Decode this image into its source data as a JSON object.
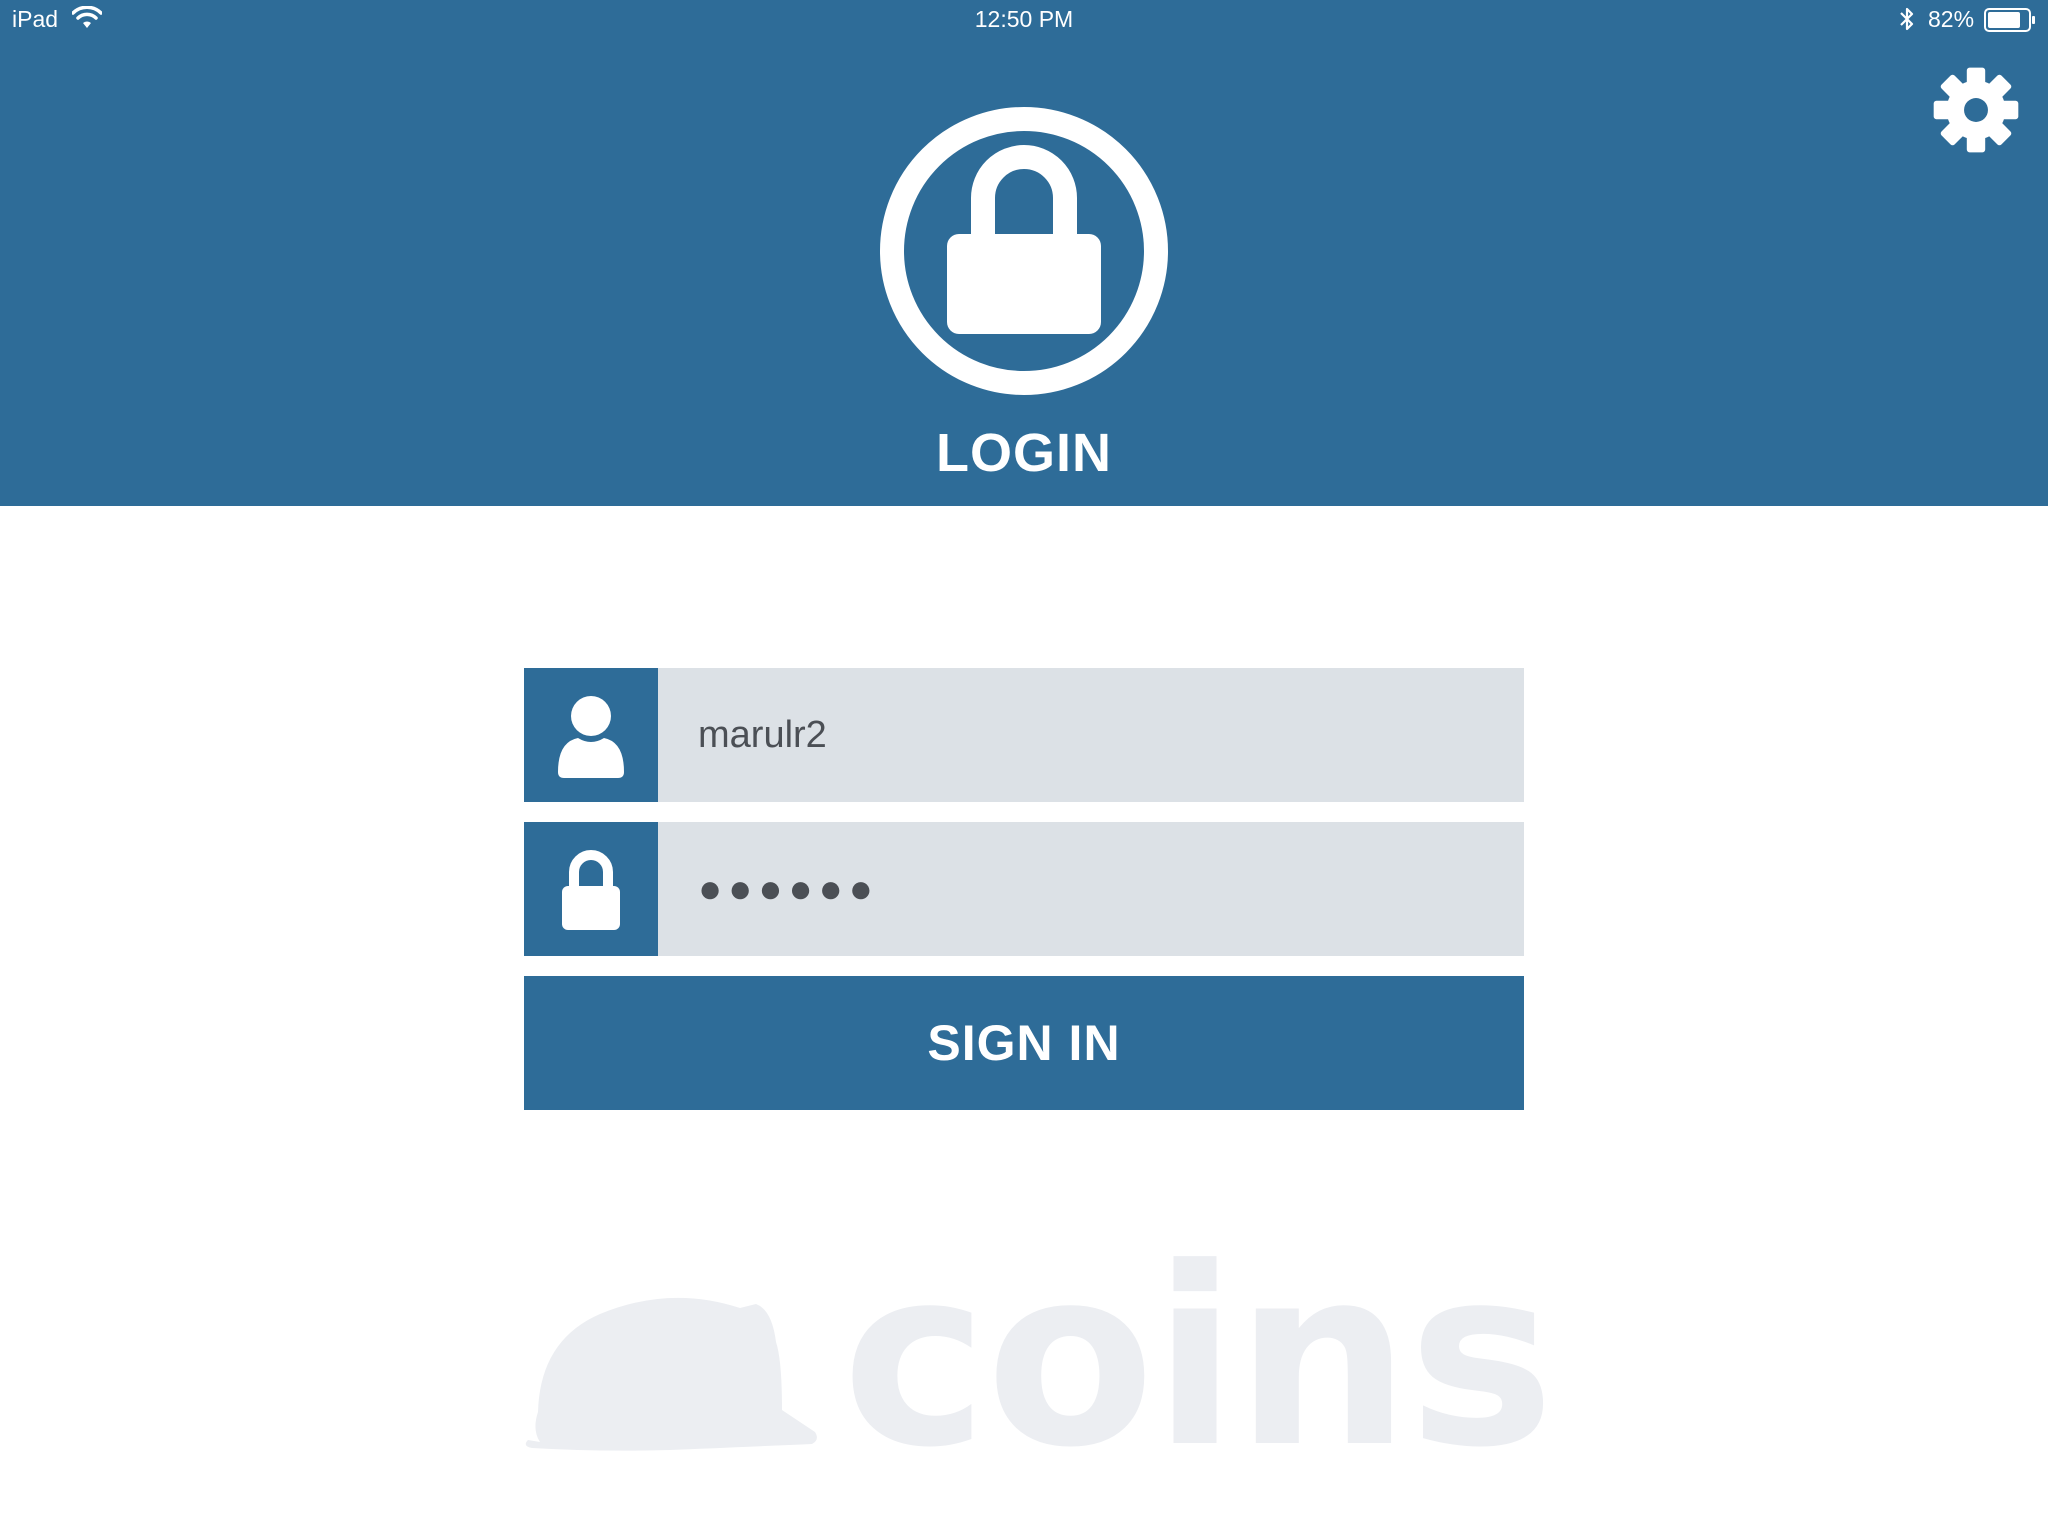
{
  "status_bar": {
    "device": "iPad",
    "time": "12:50 PM",
    "battery_percent": "82%",
    "battery_level": 0.82,
    "icons": [
      "wifi-icon",
      "bluetooth-icon",
      "battery-icon"
    ]
  },
  "header": {
    "title": "LOGIN",
    "icons": [
      "lock-icon",
      "gear-icon"
    ]
  },
  "form": {
    "username": {
      "value": "marulr2",
      "icon": "user-icon"
    },
    "password": {
      "masked_value": "●●●●●●",
      "icon": "lock-icon"
    },
    "submit_label": "SIGN IN"
  },
  "logo": {
    "wordmark": "coins",
    "icon": "hard-hat-icon"
  },
  "colors": {
    "primary": "#2e6c98",
    "field_background": "#dce1e6",
    "text": "#4b4f55",
    "logo": "#eceef2",
    "background": "#ffffff"
  }
}
